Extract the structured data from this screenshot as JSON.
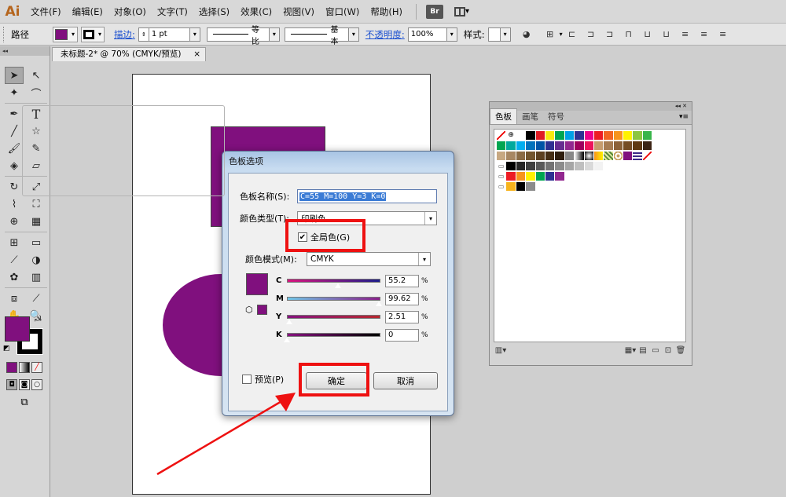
{
  "app": {
    "logo": "Ai"
  },
  "menu": [
    {
      "label": "文件(F)"
    },
    {
      "label": "编辑(E)"
    },
    {
      "label": "对象(O)"
    },
    {
      "label": "文字(T)"
    },
    {
      "label": "选择(S)"
    },
    {
      "label": "效果(C)"
    },
    {
      "label": "视图(V)"
    },
    {
      "label": "窗口(W)"
    },
    {
      "label": "帮助(H)"
    }
  ],
  "menu_extra": {
    "bridge": "Br"
  },
  "control": {
    "object_type": "路径",
    "stroke_link": "描边:",
    "stroke_weight": "1 pt",
    "profile_label": "等比",
    "brush_label": "基本",
    "opacity_link": "不透明度:",
    "opacity_value": "100%",
    "style_label": "样式:",
    "fill_color": "#80107e"
  },
  "document": {
    "tab_title": "未标题-2* @ 70% (CMYK/预览)",
    "close": "×",
    "shape_color": "#80107e"
  },
  "swatches_panel": {
    "tabs": [
      {
        "label": "色板"
      },
      {
        "label": "画笔"
      },
      {
        "label": "符号"
      }
    ],
    "rows": [
      [
        "none",
        "reg",
        "#ffffff",
        "#000000",
        "#e01c24",
        "#f6ea10",
        "#00a551",
        "#00a0e6",
        "#2e3192",
        "#ec008c",
        "#ed1c24",
        "#f26522",
        "#f7941d",
        "#fff200",
        "#8dc63f",
        "#39b54a"
      ],
      [
        "#00a651",
        "#00a99d",
        "#00aeef",
        "#0072bc",
        "#0054a6",
        "#2e3192",
        "#662d91",
        "#92278f",
        "#9e005d",
        "#ed145b",
        "#c69c6d",
        "#a67c52",
        "#8c6239",
        "#754c24",
        "#603913",
        "#3c2415"
      ],
      [
        "#c7a882",
        "#a88763",
        "#8b6b45",
        "#73552e",
        "#5c4020",
        "#452e14",
        "#2e1e0e",
        "#888888",
        "grad1",
        "grad2",
        "grad3",
        "pat1",
        "pat2",
        "#80107e",
        "pat3",
        "none2"
      ],
      [
        "folder",
        "#000000",
        "#262626",
        "#404040",
        "#595959",
        "#737373",
        "#8c8c8c",
        "#a6a6a6",
        "#bfbfbf",
        "#d9d9d9",
        "#f2f2f2",
        "#ffffff"
      ],
      [
        "folder",
        "#ed1c24",
        "#f7941d",
        "#fff200",
        "#00a651",
        "#2e3192",
        "#92278f"
      ],
      [
        "folder",
        "#f7b31d",
        "#000000",
        "#8c8c8c"
      ]
    ]
  },
  "dialog": {
    "title": "色板选项",
    "name_label": "色板名称(S):",
    "name_value": "C=55 M=100 Y=3 K=0",
    "type_label": "颜色类型(T):",
    "type_value": "印刷色",
    "global_label": "全局色(G)",
    "global_checked": true,
    "mode_label": "颜色模式(M):",
    "mode_value": "CMYK",
    "swatch_color": "#80107e",
    "channels": [
      {
        "label": "C",
        "value": "55.2",
        "fraction": 0.552,
        "gradient": "linear-gradient(90deg,#d8147e,#1c1d8a)"
      },
      {
        "label": "M",
        "value": "99.62",
        "fraction": 0.9962,
        "gradient": "linear-gradient(90deg,#70c6e6,#8a1f8a)"
      },
      {
        "label": "Y",
        "value": "2.51",
        "fraction": 0.0251,
        "gradient": "linear-gradient(90deg,#86127f,#b8272e)"
      },
      {
        "label": "K",
        "value": "0",
        "fraction": 0,
        "gradient": "linear-gradient(90deg,#86127f,#000000)"
      }
    ],
    "percent": "%",
    "preview_label": "预览(P)",
    "ok_label": "确定",
    "cancel_label": "取消"
  },
  "annotation_color": "#ee1111"
}
